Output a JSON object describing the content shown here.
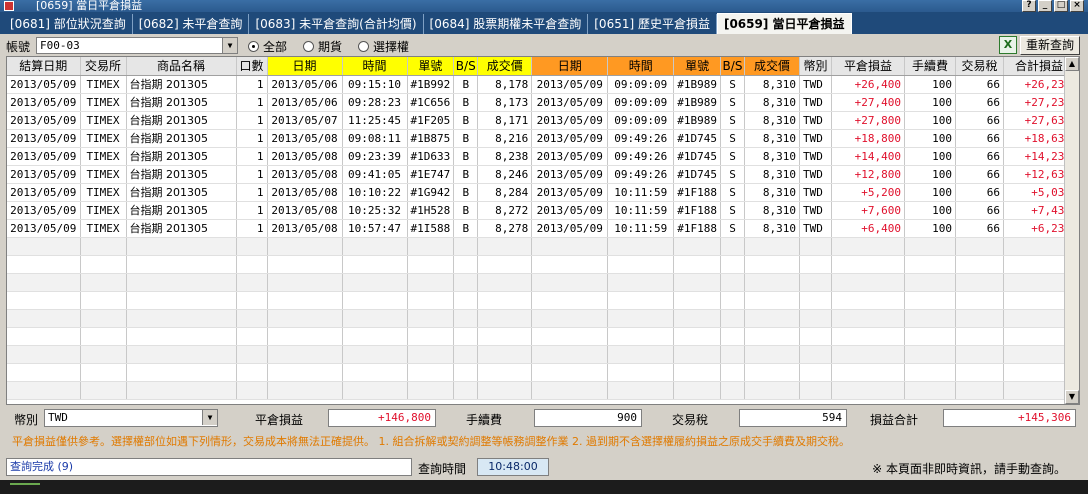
{
  "window": {
    "title": "[0659] 當日平倉損益"
  },
  "tabs": [
    {
      "label": "[0681] 部位狀況查詢",
      "active": false
    },
    {
      "label": "[0682] 未平倉查詢",
      "active": false
    },
    {
      "label": "[0683] 未平倉查詢(合計均價)",
      "active": false
    },
    {
      "label": "[0684] 股票期權未平倉查詢",
      "active": false
    },
    {
      "label": "[0651] 歷史平倉損益",
      "active": false
    },
    {
      "label": "[0659] 當日平倉損益",
      "active": true
    }
  ],
  "toolbar": {
    "account_label": "帳號",
    "account_value": "F00-03",
    "radio_all": "全部",
    "radio_futures": "期貨",
    "radio_options": "選擇權",
    "selected_radio": "all",
    "excel_icon_glyph": "X",
    "refresh_label": "重新查詢"
  },
  "grid": {
    "headers": [
      "結算日期",
      "交易所",
      "商品名稱",
      "口數",
      "日期",
      "時間",
      "單號",
      "B/S",
      "成交價",
      "日期",
      "時間",
      "單號",
      "B/S",
      "成交價",
      "幣別",
      "平倉損益",
      "手續費",
      "交易稅",
      "合計損益"
    ],
    "header_colors": [
      "#e6e6e6",
      "#e6e6e6",
      "#e6e6e6",
      "#e6e6e6",
      "#ffff00",
      "#ffff00",
      "#ffff00",
      "#ffff00",
      "#ffff00",
      "#ff9922",
      "#ff9922",
      "#ff9922",
      "#ff9922",
      "#ff9922",
      "#e6e6e6",
      "#e6e6e6",
      "#e6e6e6",
      "#e6e6e6",
      "#e6e6e6"
    ],
    "rows": [
      [
        "2013/05/09",
        "TIMEX",
        "台指期 201305",
        "1",
        "2013/05/06",
        "09:15:10",
        "#1B992",
        "B",
        "8,178",
        "2013/05/09",
        "09:09:09",
        "#1B989",
        "S",
        "8,310",
        "TWD",
        "+26,400",
        "100",
        "66",
        "+26,234"
      ],
      [
        "2013/05/09",
        "TIMEX",
        "台指期 201305",
        "1",
        "2013/05/06",
        "09:28:23",
        "#1C656",
        "B",
        "8,173",
        "2013/05/09",
        "09:09:09",
        "#1B989",
        "S",
        "8,310",
        "TWD",
        "+27,400",
        "100",
        "66",
        "+27,234"
      ],
      [
        "2013/05/09",
        "TIMEX",
        "台指期 201305",
        "1",
        "2013/05/07",
        "11:25:45",
        "#1F205",
        "B",
        "8,171",
        "2013/05/09",
        "09:09:09",
        "#1B989",
        "S",
        "8,310",
        "TWD",
        "+27,800",
        "100",
        "66",
        "+27,634"
      ],
      [
        "2013/05/09",
        "TIMEX",
        "台指期 201305",
        "1",
        "2013/05/08",
        "09:08:11",
        "#1B875",
        "B",
        "8,216",
        "2013/05/09",
        "09:49:26",
        "#1D745",
        "S",
        "8,310",
        "TWD",
        "+18,800",
        "100",
        "66",
        "+18,634"
      ],
      [
        "2013/05/09",
        "TIMEX",
        "台指期 201305",
        "1",
        "2013/05/08",
        "09:23:39",
        "#1D633",
        "B",
        "8,238",
        "2013/05/09",
        "09:49:26",
        "#1D745",
        "S",
        "8,310",
        "TWD",
        "+14,400",
        "100",
        "66",
        "+14,234"
      ],
      [
        "2013/05/09",
        "TIMEX",
        "台指期 201305",
        "1",
        "2013/05/08",
        "09:41:05",
        "#1E747",
        "B",
        "8,246",
        "2013/05/09",
        "09:49:26",
        "#1D745",
        "S",
        "8,310",
        "TWD",
        "+12,800",
        "100",
        "66",
        "+12,634"
      ],
      [
        "2013/05/09",
        "TIMEX",
        "台指期 201305",
        "1",
        "2013/05/08",
        "10:10:22",
        "#1G942",
        "B",
        "8,284",
        "2013/05/09",
        "10:11:59",
        "#1F188",
        "S",
        "8,310",
        "TWD",
        "+5,200",
        "100",
        "66",
        "+5,034"
      ],
      [
        "2013/05/09",
        "TIMEX",
        "台指期 201305",
        "1",
        "2013/05/08",
        "10:25:32",
        "#1H528",
        "B",
        "8,272",
        "2013/05/09",
        "10:11:59",
        "#1F188",
        "S",
        "8,310",
        "TWD",
        "+7,600",
        "100",
        "66",
        "+7,434"
      ],
      [
        "2013/05/09",
        "TIMEX",
        "台指期 201305",
        "1",
        "2013/05/08",
        "10:57:47",
        "#1I588",
        "B",
        "8,278",
        "2013/05/09",
        "10:11:59",
        "#1F188",
        "S",
        "8,310",
        "TWD",
        "+6,400",
        "100",
        "66",
        "+6,234"
      ]
    ],
    "empty_rows": 9,
    "profit_color": "#e0102c"
  },
  "summary": {
    "currency_label": "幣別",
    "currency_value": "TWD",
    "pnl_label": "平倉損益",
    "pnl_value": "+146,800",
    "fee_label": "手續費",
    "fee_value": "900",
    "tax_label": "交易稅",
    "tax_value": "594",
    "total_label": "損益合計",
    "total_value": "+145,306"
  },
  "notice": "平倉損益僅供參考。選擇權部位如遇下列情形，交易成本將無法正確提供。  1. 組合拆解或契約調整等帳務調整作業  2. 過到期不含選擇權履約損益之原成交手續費及期交稅。",
  "status": {
    "message": "查詢完成 (9)",
    "query_time_label": "查詢時間",
    "query_time_value": "10:48:00",
    "note": "※ 本頁面非即時資訊，請手動查詢。"
  }
}
